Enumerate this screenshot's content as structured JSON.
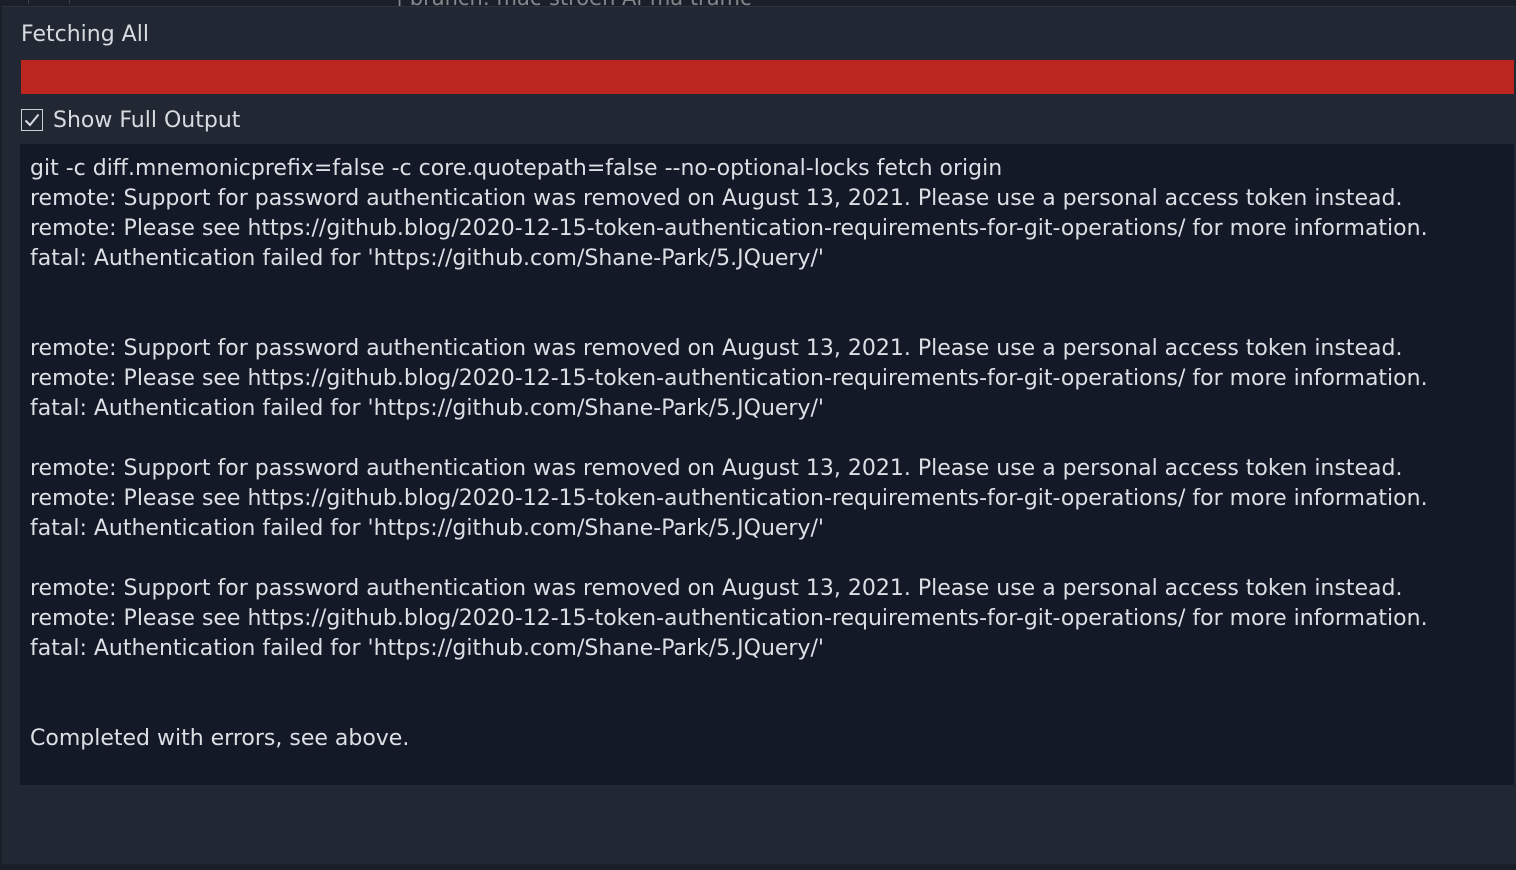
{
  "top_fragment": "| branch: mac-stroen Ai-ma tramc",
  "dialog": {
    "title": "Fetching All",
    "progress_percent": 100,
    "progress_color": "#bb261f",
    "show_full_output": {
      "label": "Show Full Output",
      "checked": true
    },
    "output_lines": [
      "git -c diff.mnemonicprefix=false -c core.quotepath=false --no-optional-locks fetch origin",
      "remote: Support for password authentication was removed on August 13, 2021. Please use a personal access token instead.",
      "remote: Please see https://github.blog/2020-12-15-token-authentication-requirements-for-git-operations/ for more information.",
      "fatal: Authentication failed for 'https://github.com/Shane-Park/5.JQuery/'",
      "",
      "",
      "remote: Support for password authentication was removed on August 13, 2021. Please use a personal access token instead.",
      "remote: Please see https://github.blog/2020-12-15-token-authentication-requirements-for-git-operations/ for more information.",
      "fatal: Authentication failed for 'https://github.com/Shane-Park/5.JQuery/'",
      "",
      "remote: Support for password authentication was removed on August 13, 2021. Please use a personal access token instead.",
      "remote: Please see https://github.blog/2020-12-15-token-authentication-requirements-for-git-operations/ for more information.",
      "fatal: Authentication failed for 'https://github.com/Shane-Park/5.JQuery/'",
      "",
      "remote: Support for password authentication was removed on August 13, 2021. Please use a personal access token instead.",
      "remote: Please see https://github.blog/2020-12-15-token-authentication-requirements-for-git-operations/ for more information.",
      "fatal: Authentication failed for 'https://github.com/Shane-Park/5.JQuery/'",
      "",
      "",
      "Completed with errors, see above."
    ]
  }
}
